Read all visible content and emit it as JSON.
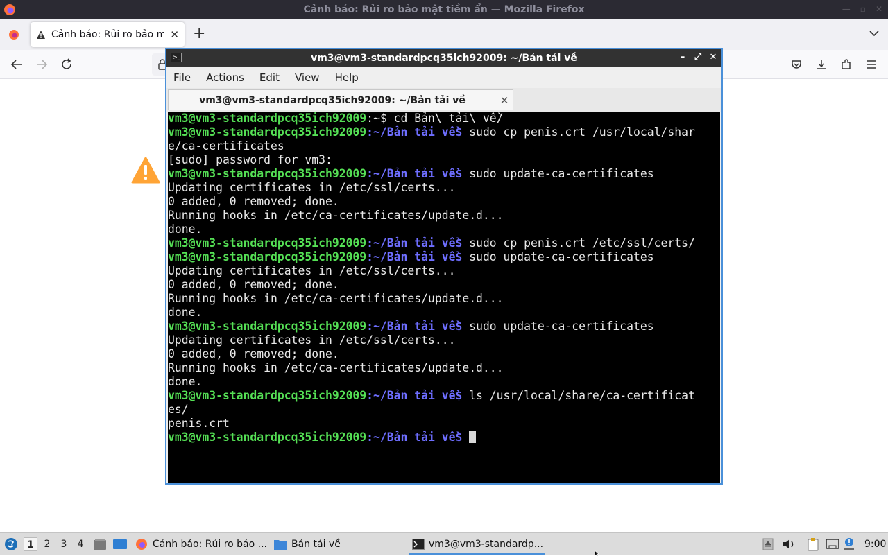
{
  "firefox": {
    "window_title": "Cảnh báo: Rủi ro bảo mật tiềm ẩn — Mozilla Firefox",
    "tab_title": "Cảnh báo: Rủi ro bảo mật tiềm ẩn",
    "icons": [
      "firefox-icon",
      "warning-icon",
      "close-icon",
      "plus-icon",
      "chevron-down-icon",
      "back-icon",
      "forward-icon",
      "reload-icon",
      "lock-icon",
      "pocket-icon",
      "download-icon",
      "extensions-icon",
      "menu-icon"
    ]
  },
  "terminal": {
    "window_title": "vm3@vm3-standardpcq35ich92009: ~/Bản tải về",
    "tab_title": "vm3@vm3-standardpcq35ich92009: ~/Bản tải về",
    "menu": [
      "File",
      "Actions",
      "Edit",
      "View",
      "Help"
    ],
    "lines": [
      {
        "user": "vm3@vm3-standardpcq35ich92009",
        "path": ":~$ ",
        "cmd": "cd Bản\\ tải\\ về/"
      },
      {
        "user": "vm3@vm3-standardpcq35ich92009",
        "path": ":~/Bản tải về$ ",
        "cmd": "sudo cp penis.crt /usr/local/shar"
      },
      {
        "text": "e/ca-certificates"
      },
      {
        "text": "[sudo] password for vm3:"
      },
      {
        "user": "vm3@vm3-standardpcq35ich92009",
        "path": ":~/Bản tải về$ ",
        "cmd": "sudo update-ca-certificates"
      },
      {
        "text": "Updating certificates in /etc/ssl/certs..."
      },
      {
        "text": "0 added, 0 removed; done."
      },
      {
        "text": "Running hooks in /etc/ca-certificates/update.d..."
      },
      {
        "text": "done."
      },
      {
        "user": "vm3@vm3-standardpcq35ich92009",
        "path": ":~/Bản tải về$ ",
        "cmd": "sudo cp penis.crt /etc/ssl/certs/"
      },
      {
        "user": "vm3@vm3-standardpcq35ich92009",
        "path": ":~/Bản tải về$ ",
        "cmd": "sudo update-ca-certificates"
      },
      {
        "text": "Updating certificates in /etc/ssl/certs..."
      },
      {
        "text": "0 added, 0 removed; done."
      },
      {
        "text": "Running hooks in /etc/ca-certificates/update.d..."
      },
      {
        "text": "done."
      },
      {
        "user": "vm3@vm3-standardpcq35ich92009",
        "path": ":~/Bản tải về$ ",
        "cmd": "sudo update-ca-certificates"
      },
      {
        "text": "Updating certificates in /etc/ssl/certs..."
      },
      {
        "text": "0 added, 0 removed; done."
      },
      {
        "text": "Running hooks in /etc/ca-certificates/update.d..."
      },
      {
        "text": "done."
      },
      {
        "user": "vm3@vm3-standardpcq35ich92009",
        "path": ":~/Bản tải về$ ",
        "cmd": "ls /usr/local/share/ca-certificat"
      },
      {
        "text": "es/"
      },
      {
        "text": "penis.crt"
      },
      {
        "user": "vm3@vm3-standardpcq35ich92009",
        "path": ":~/Bản tải về$ ",
        "cmd": ""
      }
    ]
  },
  "taskbar": {
    "workspaces": [
      "1",
      "2",
      "3",
      "4"
    ],
    "tasks": {
      "firefox": "Cảnh báo: Rủi ro bảo ...",
      "files": "Bản tải về",
      "terminal": "vm3@vm3-standardp..."
    },
    "clock": "9:00"
  },
  "colors": {
    "prompt_user": "#55e055",
    "prompt_path": "#6e6eff",
    "accent": "#4a90d9",
    "warning": "#ffa436"
  }
}
